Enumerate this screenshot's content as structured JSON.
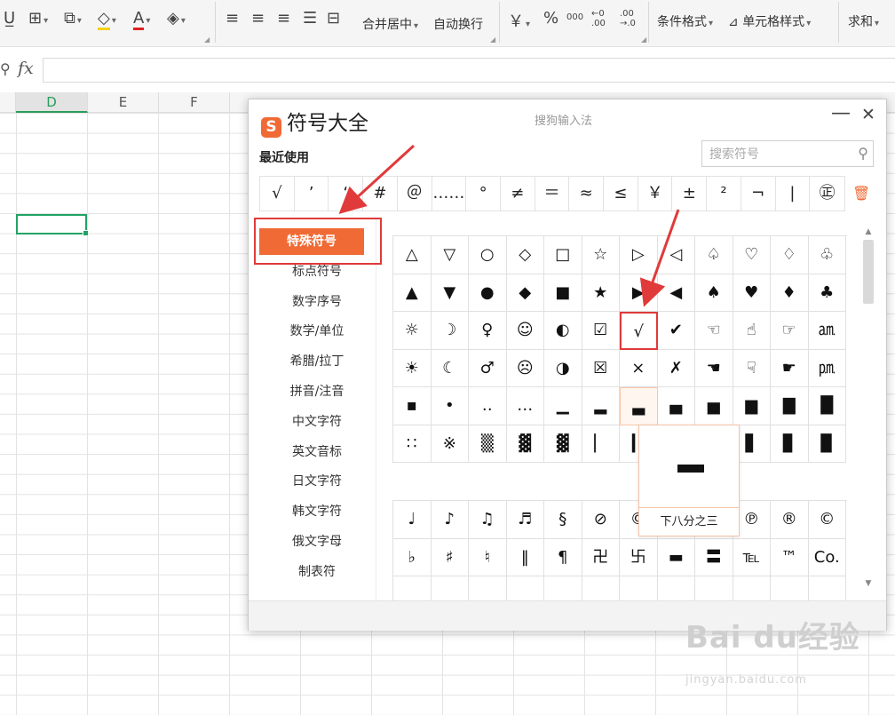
{
  "toolbar": {
    "merge_center": "合并居中",
    "auto_wrap": "自动换行",
    "currency": "￥",
    "percent": "%",
    "thousands": "000",
    "dec_inc": "←0 .00",
    "dec_dec": ".00 →.0",
    "cond_format": "条件格式",
    "cell_style": "单元格样式",
    "sum": "求和"
  },
  "formula_bar": {
    "fx": "fx",
    "value": ""
  },
  "columns": [
    "D",
    "E",
    "F"
  ],
  "dialog": {
    "title": "符号大全",
    "logo_text": "S",
    "subtitle": "搜狗输入法",
    "minimize": "—",
    "close": "✕",
    "recent_title": "最近使用",
    "search_placeholder": "搜索符号",
    "recent": [
      "√",
      "’",
      "‘",
      "#",
      "＠",
      "……",
      "°",
      "≠",
      "＝",
      "≈",
      "≤",
      "￥",
      "±",
      "²",
      "¬",
      "|",
      "㊣"
    ],
    "categories": [
      "特殊符号",
      "标点符号",
      "数字序号",
      "数学/单位",
      "希腊/拉丁",
      "拼音/注音",
      "中文字符",
      "英文音标",
      "日文字符",
      "韩文字符",
      "俄文字母",
      "制表符"
    ],
    "active_category": "特殊符号",
    "grid1": [
      [
        "△",
        "▽",
        "○",
        "◇",
        "□",
        "☆",
        "▷",
        "◁",
        "♤",
        "♡",
        "♢",
        "♧"
      ],
      [
        "▲",
        "▼",
        "●",
        "◆",
        "■",
        "★",
        "▶",
        "◀",
        "♠",
        "♥",
        "♦",
        "♣"
      ],
      [
        "☼",
        "☽",
        "♀",
        "☺",
        "◐",
        "☑",
        "√",
        "✔",
        "☜",
        "☝",
        "☞",
        "㏂"
      ],
      [
        "☀",
        "☾",
        "♂",
        "☹",
        "◑",
        "☒",
        "×",
        "✗",
        "☚",
        "☟",
        "☛",
        "㏘"
      ],
      [
        "▪",
        "•",
        "‥",
        "…",
        "▁",
        "▂",
        "▃",
        "▄",
        "▅",
        "▆",
        "▇",
        "█"
      ],
      [
        "∷",
        "※",
        "▒",
        "▓",
        "▓",
        "▏",
        "▎",
        "▍",
        "▌",
        "▋",
        "▊",
        "▉"
      ]
    ],
    "grid2": [
      [
        "♩",
        "♪",
        "♫",
        "♬",
        "§",
        "⊘",
        "©",
        "",
        "",
        "℗",
        "®",
        "©"
      ],
      [
        "♭",
        "♯",
        "♮",
        "‖",
        "¶",
        "卍",
        "卐",
        "▬",
        "〓",
        "℡",
        "™",
        "Co."
      ],
      [
        "",
        "",
        "",
        "",
        "",
        "",
        "",
        "",
        "",
        "",
        "",
        ""
      ]
    ],
    "preview_label": "下八分之三"
  },
  "watermark": {
    "brand": "Bai du经验",
    "url": "jingyan.baidu.com"
  }
}
